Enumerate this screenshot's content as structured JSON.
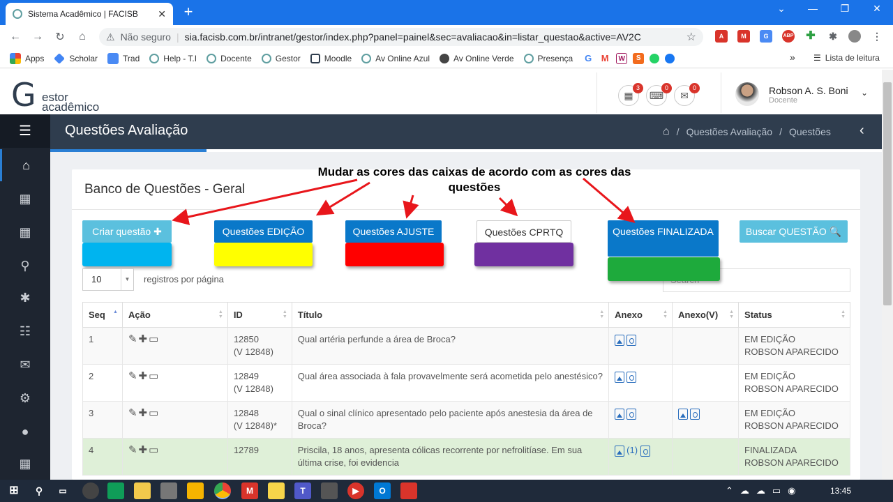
{
  "browser": {
    "tab_title": "Sistema Acadêmico | FACISB",
    "close_glyph": "✕",
    "new_tab_glyph": "+",
    "not_secure_label": "Não seguro",
    "url": "sia.facisb.com.br/intranet/gestor/index.php?panel=painel&sec=avaliacao&in=listar_questao&active=AV2C",
    "bookmarks": [
      "Apps",
      "Scholar",
      "Trad",
      "Help - T.I",
      "Docente",
      "Gestor",
      "Moodle",
      "Av Online Azul",
      "Av Online Verde",
      "Presença"
    ],
    "bookmarks_more": "»",
    "reading_list": "Lista de leitura"
  },
  "header": {
    "logo_g": "G",
    "logo_line1": "estor",
    "logo_line2": "acadêmico",
    "badges": {
      "calendar": "3",
      "keyboard": "0",
      "mail": "0"
    },
    "user_name": "Robson A. S. Boni",
    "user_role": "Docente"
  },
  "page": {
    "title": "Questões Avaliação",
    "breadcrumb": [
      "Questões Avaliação",
      "/",
      "Questões"
    ],
    "breadcrumb_sep": "/"
  },
  "card": {
    "title": "Banco de Questões - Geral",
    "buttons": {
      "criar": "Criar questão ✚",
      "edicao": "Questões EDIÇÃO",
      "ajuste": "Questões AJUSTE",
      "cprtq": "Questões CPRTQ",
      "finalizada": "Questões FINALIZADA",
      "buscar": "Buscar QUESTÃO 🔍"
    },
    "swatch_colors": {
      "criar": "#00b4ef",
      "edicao": "#ffff00",
      "ajuste": "#ff0000",
      "cprtq": "#7030a0",
      "finalizada": "#1eaa3c"
    },
    "page_length": "10",
    "page_length_label": "registros por página",
    "search_placeholder": "Search"
  },
  "annotation": "Mudar as cores das caixas de acordo com as cores das questões",
  "table": {
    "headers": [
      "Seq",
      "Ação",
      "ID",
      "Título",
      "Anexo",
      "Anexo(V)",
      "Status"
    ],
    "rows": [
      {
        "seq": "1",
        "id": "12850",
        "idv": "(V 12848)",
        "title": "Qual artéria perfunde a área de Broca?",
        "anexo_count": "",
        "has_anexo_v": false,
        "status": "EM EDIÇÃO",
        "author": "ROBSON APARECIDO"
      },
      {
        "seq": "2",
        "id": "12849",
        "idv": "(V 12848)",
        "title": "Qual área associada à fala provavelmente será acometida pelo anestésico?",
        "anexo_count": "",
        "has_anexo_v": false,
        "status": "EM EDIÇÃO",
        "author": "ROBSON APARECIDO"
      },
      {
        "seq": "3",
        "id": "12848",
        "idv": "(V 12848)*",
        "title": "Qual o sinal clínico apresentado pelo paciente após anestesia da área de Broca?",
        "anexo_count": "",
        "has_anexo_v": true,
        "status": "EM EDIÇÃO",
        "author": "ROBSON APARECIDO"
      },
      {
        "seq": "4",
        "id": "12789",
        "idv": "",
        "title": "Priscila, 18 anos, apresenta cólicas recorrente por nefrolitíase. Em sua última crise, foi evidencia",
        "anexo_count": "(1)",
        "has_anexo_v": false,
        "status": "FINALIZADA",
        "author": "ROBSON APARECIDO"
      }
    ]
  },
  "taskbar": {
    "clock": "13:45"
  }
}
